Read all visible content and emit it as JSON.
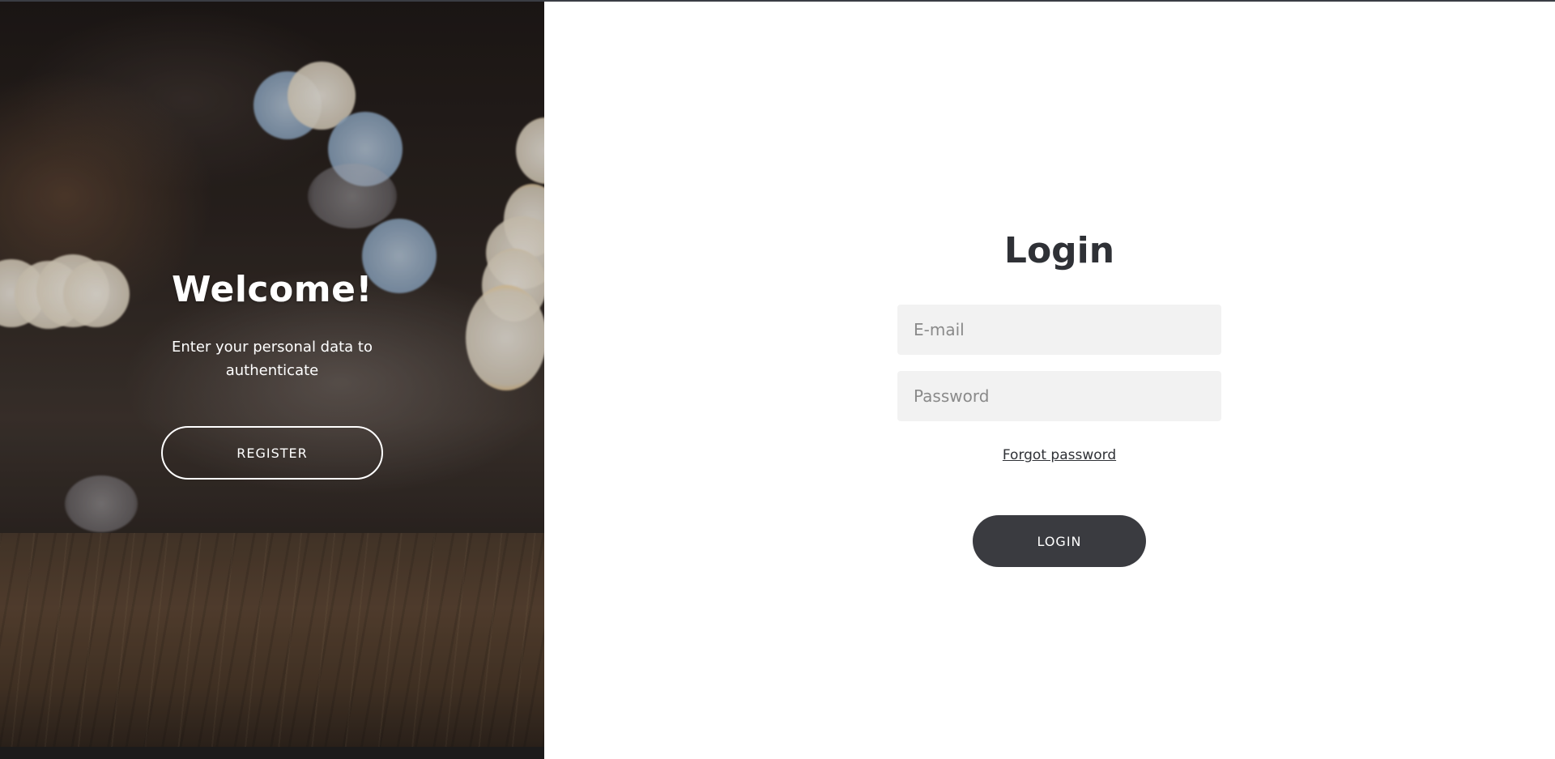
{
  "welcome": {
    "title": "Welcome!",
    "text": "Enter your personal data to authenticate",
    "register_label": "REGISTER"
  },
  "login": {
    "title": "Login",
    "email_placeholder": "E-mail",
    "password_placeholder": "Password",
    "forgot_label": "Forgot password",
    "login_label": "LOGIN"
  },
  "colors": {
    "dark_button": "#3a3b40",
    "input_background": "#f2f2f2",
    "text_dark": "#2f3136"
  }
}
